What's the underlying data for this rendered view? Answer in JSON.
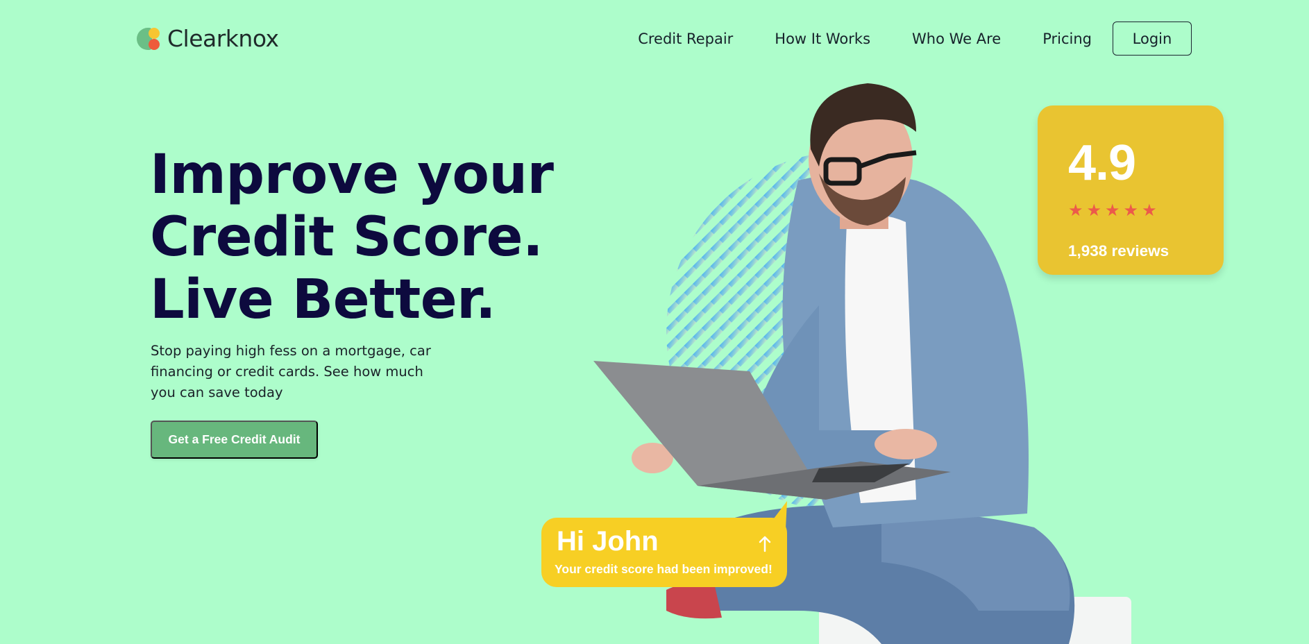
{
  "brand": {
    "name": "Clearknox"
  },
  "nav": {
    "links": [
      "Credit Repair",
      "How It Works",
      "Who We Are",
      "Pricing"
    ],
    "login_label": "Login"
  },
  "hero": {
    "headline_lines": [
      "Improve your",
      "Credit Score.",
      "Live Better."
    ],
    "subcopy": "Stop paying high fess on a mortgage, car financing or credit cards. See how much you can save today",
    "cta_label": "Get a Free Credit Audit"
  },
  "rating": {
    "value": "4.9",
    "stars": 5,
    "reviews": "1,938 reviews"
  },
  "notification": {
    "title": "Hi John",
    "message": "Your credit score had been improved!"
  },
  "colors": {
    "background": "#adfdcb",
    "headline": "#0d0a3e",
    "cta": "#67b77d",
    "rating_card": "#e9c431",
    "star": "#ec5a4a",
    "bubble": "#f7cf24",
    "logo_green": "#6bbf86",
    "logo_yellow": "#f7c531",
    "logo_red": "#ee5b3b"
  },
  "icons": {
    "logo": "clearknox-logo-icon",
    "star": "star-icon",
    "arrow": "arrow-up-icon"
  }
}
